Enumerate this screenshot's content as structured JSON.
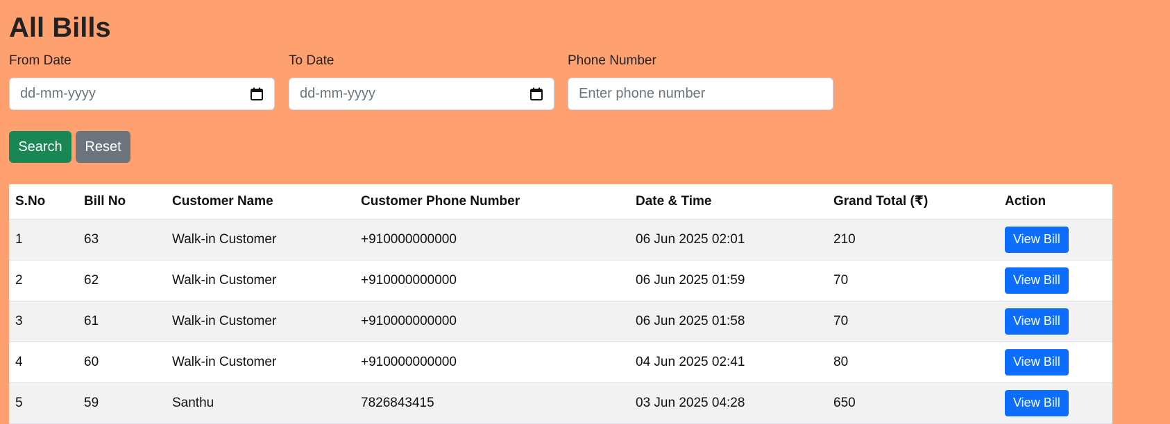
{
  "page": {
    "title": "All Bills"
  },
  "filters": {
    "from_date": {
      "label": "From Date",
      "placeholder": "dd-mm-yyyy"
    },
    "to_date": {
      "label": "To Date",
      "placeholder": "dd-mm-yyyy"
    },
    "phone": {
      "label": "Phone Number",
      "placeholder": "Enter phone number"
    }
  },
  "buttons": {
    "search": "Search",
    "reset": "Reset"
  },
  "colors": {
    "background": "#ffa070",
    "search": "#198754",
    "reset": "#6c757d",
    "view_bill": "#0d6efd"
  },
  "icons": {
    "date_picker": "calendar-icon"
  },
  "table": {
    "columns": [
      "S.No",
      "Bill No",
      "Customer Name",
      "Customer Phone Number",
      "Date & Time",
      "Grand Total (₹)",
      "Action"
    ],
    "rows": [
      {
        "sno": "1",
        "bill_no": "63",
        "customer": "Walk-in Customer",
        "phone": "+910000000000",
        "datetime": "06 Jun 2025 02:01",
        "total": "210",
        "action": "View Bill"
      },
      {
        "sno": "2",
        "bill_no": "62",
        "customer": "Walk-in Customer",
        "phone": "+910000000000",
        "datetime": "06 Jun 2025 01:59",
        "total": "70",
        "action": "View Bill"
      },
      {
        "sno": "3",
        "bill_no": "61",
        "customer": "Walk-in Customer",
        "phone": "+910000000000",
        "datetime": "06 Jun 2025 01:58",
        "total": "70",
        "action": "View Bill"
      },
      {
        "sno": "4",
        "bill_no": "60",
        "customer": "Walk-in Customer",
        "phone": "+910000000000",
        "datetime": "04 Jun 2025 02:41",
        "total": "80",
        "action": "View Bill"
      },
      {
        "sno": "5",
        "bill_no": "59",
        "customer": "Santhu",
        "phone": "7826843415",
        "datetime": "03 Jun 2025 04:28",
        "total": "650",
        "action": "View Bill"
      }
    ]
  }
}
